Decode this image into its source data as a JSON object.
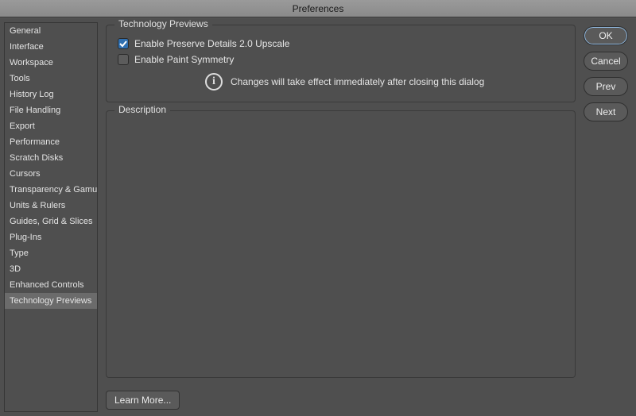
{
  "title": "Preferences",
  "sidebar": {
    "items": [
      {
        "label": "General"
      },
      {
        "label": "Interface"
      },
      {
        "label": "Workspace"
      },
      {
        "label": "Tools"
      },
      {
        "label": "History Log"
      },
      {
        "label": "File Handling"
      },
      {
        "label": "Export"
      },
      {
        "label": "Performance"
      },
      {
        "label": "Scratch Disks"
      },
      {
        "label": "Cursors"
      },
      {
        "label": "Transparency & Gamut"
      },
      {
        "label": "Units & Rulers"
      },
      {
        "label": "Guides, Grid & Slices"
      },
      {
        "label": "Plug-Ins"
      },
      {
        "label": "Type"
      },
      {
        "label": "3D"
      },
      {
        "label": "Enhanced Controls"
      },
      {
        "label": "Technology Previews"
      }
    ],
    "selected_index": 17
  },
  "panel": {
    "group_title": "Technology Previews",
    "checkboxes": [
      {
        "label": "Enable Preserve Details 2.0 Upscale",
        "checked": true
      },
      {
        "label": "Enable Paint Symmetry",
        "checked": false
      }
    ],
    "notice": "Changes will take effect immediately after closing this dialog",
    "description_title": "Description",
    "learn_more": "Learn More..."
  },
  "buttons": {
    "ok": "OK",
    "cancel": "Cancel",
    "prev": "Prev",
    "next": "Next"
  }
}
